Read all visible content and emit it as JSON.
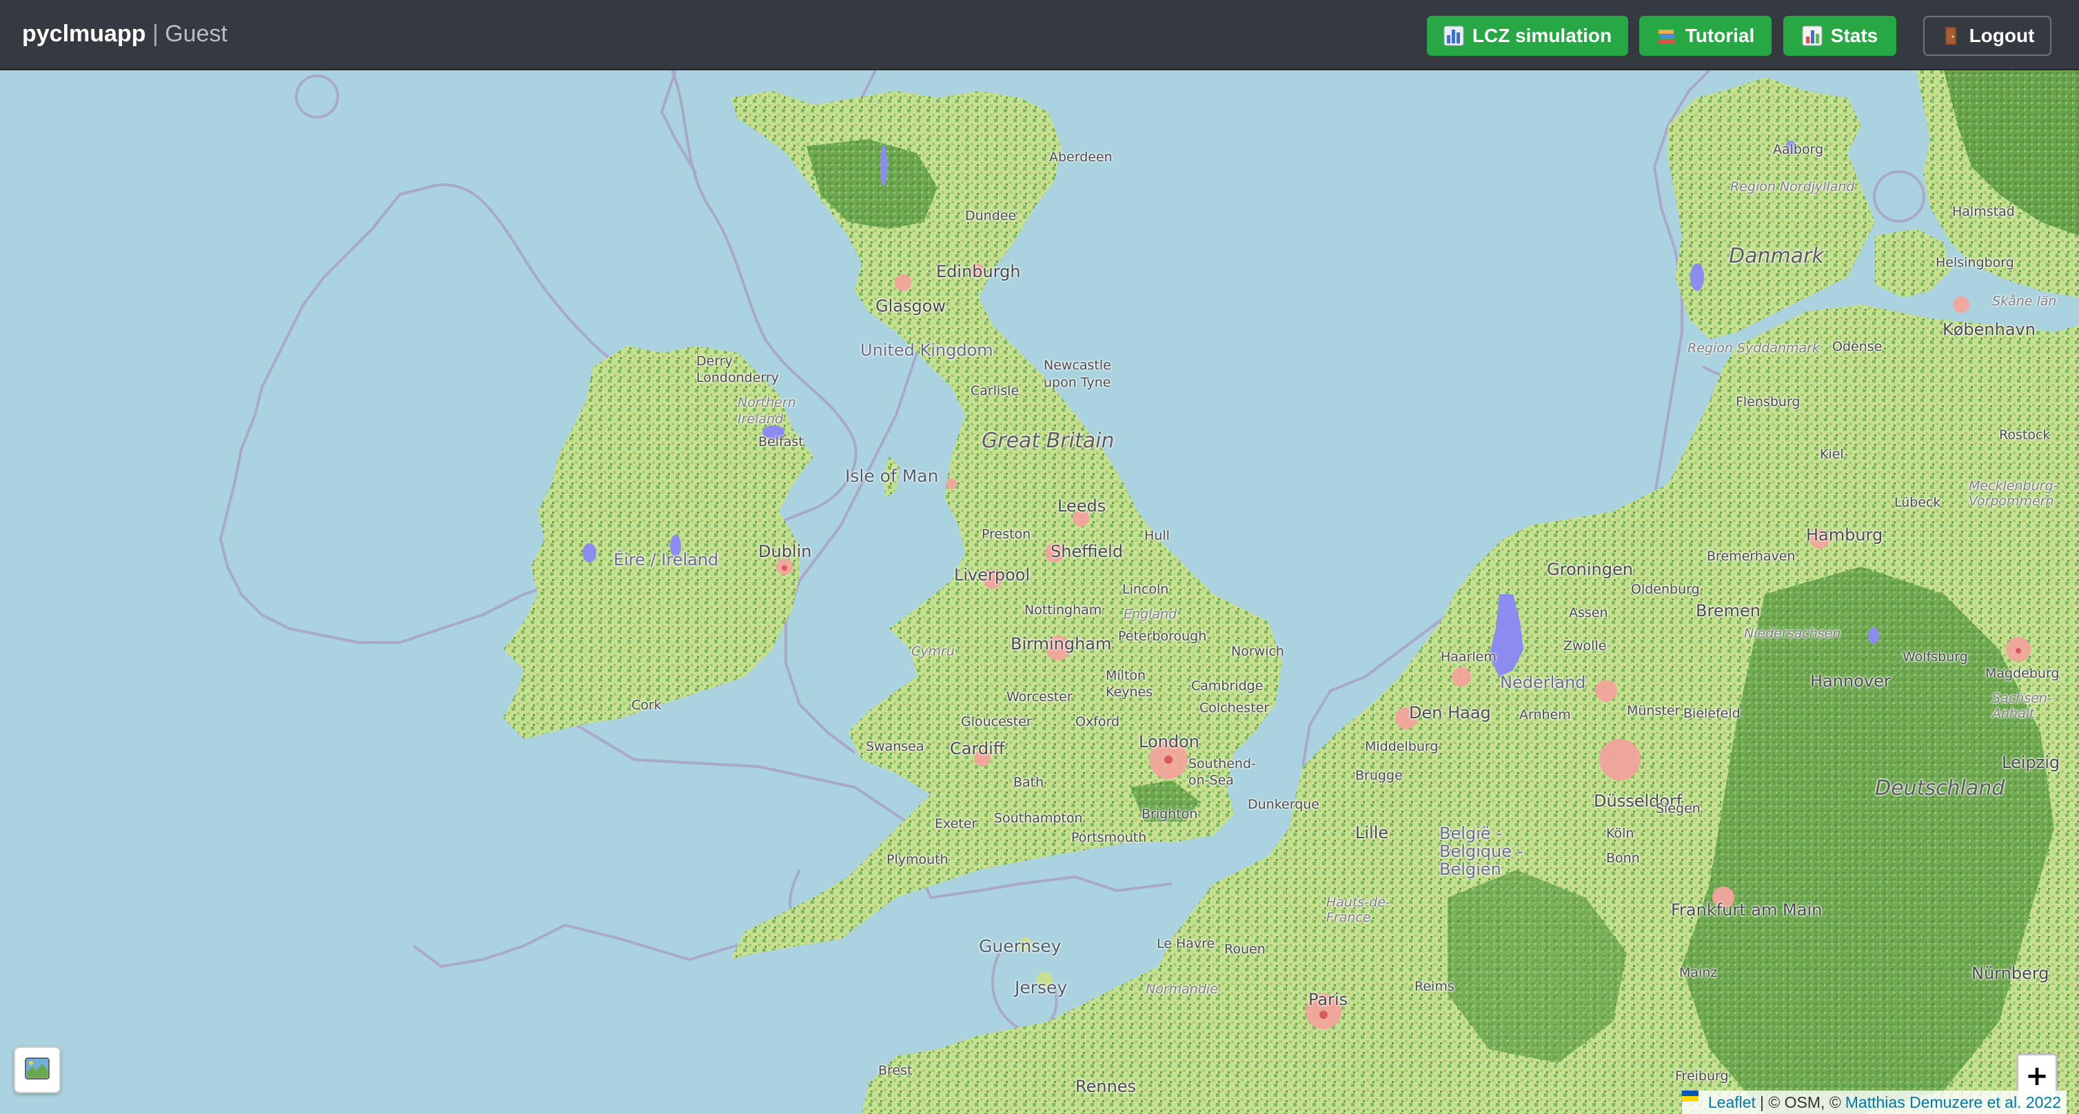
{
  "navbar": {
    "app_name": "pyclmuapp",
    "separator": "|",
    "user": "Guest",
    "buttons": [
      {
        "label": "LCZ simulation",
        "icon": "bar-chart-icon"
      },
      {
        "label": "Tutorial",
        "icon": "books-icon"
      },
      {
        "label": "Stats",
        "icon": "bar-chart-icon"
      },
      {
        "label": "Logout",
        "icon": "door-icon"
      }
    ]
  },
  "map": {
    "labels": {
      "aberdeen": "Aberdeen",
      "dundee": "Dundee",
      "edinburgh": "Edinburgh",
      "glasgow": "Glasgow",
      "united_kingdom": "United Kingdom",
      "newcastle": "Newcastle\nupon Tyne",
      "carlisle": "Carlisle",
      "great_britain": "Great Britain",
      "isle_of_man": "Isle of Man",
      "derry": "Derry\nLondonderry",
      "northern_ireland": "Northern\nIreland",
      "belfast": "Belfast",
      "dublin": "Dublin",
      "eire": "Éire / Ireland",
      "cork": "Cork",
      "leeds": "Leeds",
      "preston": "Preston",
      "sheffield": "Sheffield",
      "hull": "Hull",
      "liverpool": "Liverpool",
      "lincoln": "Lincoln",
      "nottingham": "Nottingham",
      "england": "England",
      "birmingham": "Birmingham",
      "peterborough": "Peterborough",
      "norwich": "Norwich",
      "cymru": "Cymru",
      "milton_keynes": "Milton\nKeynes",
      "cambridge": "Cambridge",
      "worcester": "Worcester",
      "colchester": "Colchester",
      "gloucester": "Gloucester",
      "oxford": "Oxford",
      "london": "London",
      "swansea": "Swansea",
      "cardiff": "Cardiff",
      "southend": "Southend-\non-Sea",
      "bath": "Bath",
      "exeter": "Exeter",
      "southampton": "Southampton",
      "brighton": "Brighton",
      "portsmouth": "Portsmouth",
      "plymouth": "Plymouth",
      "guernsey": "Guernsey",
      "jersey": "Jersey",
      "le_havre": "Le Havre",
      "rouen": "Rouen",
      "paris": "Paris",
      "normandie": "Normandie",
      "hauts_de_france": "Hauts-de-\nFrance",
      "lille": "Lille",
      "brugge": "Brugge",
      "dunkerque": "Dunkerque",
      "middelburg": "Middelburg",
      "den_haag": "Den Haag",
      "haarlem": "Haarlem",
      "nederland": "Nederland",
      "groningen": "Groningen",
      "oldenburg": "Oldenburg",
      "bremen": "Bremen",
      "hamburg": "Hamburg",
      "bremerhaven": "Bremerhaven",
      "hannover": "Hannover",
      "bielefeld": "Bielefeld",
      "dusseldorf": "Düsseldorf",
      "siegen": "Siegen",
      "belgie": "België -\nBelgique -\nBelgien",
      "frankfurt": "Frankfurt am Main",
      "leipzig": "Leipzig",
      "deutschland": "Deutschland",
      "danmark": "Danmark",
      "kobenhavn": "København",
      "odense": "Odense",
      "helsingborg": "Helsingborg",
      "halmstad": "Halmstad",
      "flensburg": "Flensburg",
      "aalborg": "Aalborg",
      "region_nordjylland": "Region Nordjylland",
      "region_syddanmark": "Region Syddanmark",
      "lubeck": "Lübeck",
      "niedersachsen": "Niedersachsen",
      "sachsen_anhalt": "Sachsen-\nAnhalt",
      "nurnberg": "Nürnberg",
      "brest": "Brest",
      "rennes": "Rennes",
      "reims": "Reims",
      "wolfsburg": "Wolfsburg",
      "assen": "Assen",
      "zwolle": "Zwolle",
      "arnhem": "Arnhem",
      "munster": "Münster",
      "koln": "Köln",
      "bonn": "Bonn",
      "mainz": "Mainz",
      "freiburg": "Freiburg",
      "magdeburg": "Magdeburg",
      "rostock": "Rostock",
      "kiel": "Kiel",
      "mecklenburg": "Mecklenburg-\nVorpommern",
      "skane": "Skåne län"
    }
  },
  "zoom": {
    "in": "+",
    "out": "−"
  },
  "layer_button": {
    "icon": "map-layers-icon"
  },
  "attribution": {
    "leaflet": "Leaflet",
    "osm": "| © OSM, ©",
    "author": "Matthias Demuzere et al. 2022"
  },
  "colors": {
    "navbar": "#343a40",
    "button_green": "#28a745",
    "sea": "#aad3df",
    "land": "#c6df8f",
    "forest": "#6aa84f",
    "urban": "#f4a6a0",
    "border": "#9a9ab8",
    "water": "#8c8cf0"
  }
}
